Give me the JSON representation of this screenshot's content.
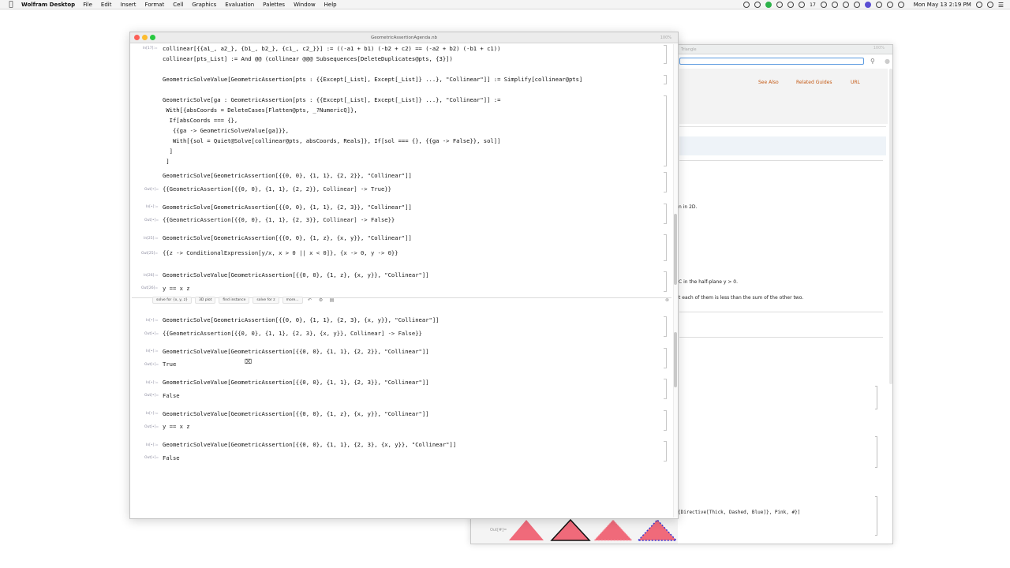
{
  "menubar": {
    "app_name": "Wolfram Desktop",
    "items": [
      "File",
      "Edit",
      "Insert",
      "Format",
      "Cell",
      "Graphics",
      "Evaluation",
      "Palettes",
      "Window",
      "Help"
    ],
    "status_badge": "17",
    "clock": "Mon May 13  2:19 PM"
  },
  "doc_window": {
    "title": "Triangle",
    "zoom": "100%",
    "nav_links": [
      "See Also",
      "Related Guides",
      "URL"
    ],
    "text_1": "n in 2D.",
    "text_2": "C in the half-plane y > 0.",
    "text_3": "t each of them is less than the sum of the other two.",
    "code_1": "{Directive[Thick, Dashed, Blue]}, Pink, #}]",
    "out_label": "Out[#]="
  },
  "notebook": {
    "title": "GeometricAssertionAgenda.nb",
    "zoom": "100%",
    "cells": [
      {
        "label": "In[17]:=",
        "lines": [
          "collinear[{{a1_, a2_}, {b1_, b2_}, {c1_, c2_}}] := ((-a1 + b1) (-b2 + c2) == (-a2 + b2) (-b1 + c1))",
          "collinear[pts_List] := And @@ (collinear @@@ Subsequences[DeleteDuplicates@pts, {3}])"
        ]
      },
      {
        "label": "",
        "lines": [
          "GeometricSolveValue[GeometricAssertion[pts : {{Except[_List], Except[_List]} ...}, \"Collinear\"]] := Simplify[collinear@pts]"
        ]
      },
      {
        "label": "",
        "lines": [
          "GeometricSolve[ga : GeometricAssertion[pts : {{Except[_List], Except[_List]} ...}, \"Collinear\"]] :=",
          " With[{absCoords = DeleteCases[Flatten@pts, _?NumericQ]},",
          "  If[absCoords === {},",
          "   {{ga -> GeometricSolveValue[ga]}},",
          "   With[{sol = Quiet@Solve[collinear@pts, absCoords, Reals]}, If[sol === {}, {{ga -> False}}, sol]]",
          "  ]",
          " ]"
        ]
      }
    ],
    "io_top": [
      {
        "in_label": "",
        "input": "GeometricSolve[GeometricAssertion[{{0, 0}, {1, 1}, {2, 2}}, \"Collinear\"]]",
        "out_label": "Out[•]=",
        "output": "{{GeometricAssertion[{{0, 0}, {1, 1}, {2, 2}}, Collinear] -> True}}"
      },
      {
        "in_label": "In[•]:=",
        "input": "GeometricSolve[GeometricAssertion[{{0, 0}, {1, 1}, {2, 3}}, \"Collinear\"]]",
        "out_label": "Out[•]=",
        "output": "{{GeometricAssertion[{{0, 0}, {1, 1}, {2, 3}}, Collinear] -> False}}"
      },
      {
        "in_label": "In[25]:=",
        "input": "GeometricSolve[GeometricAssertion[{{0, 0}, {1, z}, {x, y}}, \"Collinear\"]]",
        "out_label": "Out[25]=",
        "output": "{{z -> ConditionalExpression[y/x, x > 0 || x < 0]}, {x -> 0, y -> 0}}"
      },
      {
        "in_label": "In[26]:=",
        "input": "GeometricSolveValue[GeometricAssertion[{{0, 0}, {1, z}, {x, y}}, \"Collinear\"]]",
        "out_label": "Out[26]=",
        "output": "y == x z"
      }
    ],
    "suggestions": [
      "solve for {x, y, z}",
      "3D plot",
      "find instance",
      "solve for z",
      "more..."
    ],
    "io_bottom": [
      {
        "in_label": "In[•]:=",
        "input": "GeometricSolve[GeometricAssertion[{{0, 0}, {1, 1}, {2, 3}, {x, y}}, \"Collinear\"]]",
        "out_label": "Out[•]=",
        "output": "{{GeometricAssertion[{{0, 0}, {1, 1}, {2, 3}, {x, y}}, Collinear] -> False}}"
      },
      {
        "in_label": "In[•]:=",
        "input": "GeometricSolveValue[GeometricAssertion[{{0, 0}, {1, 1}, {2, 2}}, \"Collinear\"]]",
        "out_label": "Out[•]=",
        "output": "True"
      },
      {
        "in_label": "In[•]:=",
        "input": "GeometricSolveValue[GeometricAssertion[{{0, 0}, {1, 1}, {2, 3}}, \"Collinear\"]]",
        "out_label": "Out[•]=",
        "output": "False"
      },
      {
        "in_label": "In[•]:=",
        "input": "GeometricSolveValue[GeometricAssertion[{{0, 0}, {1, z}, {x, y}}, \"Collinear\"]]",
        "out_label": "Out[•]=",
        "output": "y == x z"
      },
      {
        "in_label": "In[•]:=",
        "input": "GeometricSolveValue[GeometricAssertion[{{0, 0}, {1, 1}, {2, 3}, {x, y}}, \"Collinear\"]]",
        "out_label": "Out[•]=",
        "output": "False"
      }
    ]
  }
}
